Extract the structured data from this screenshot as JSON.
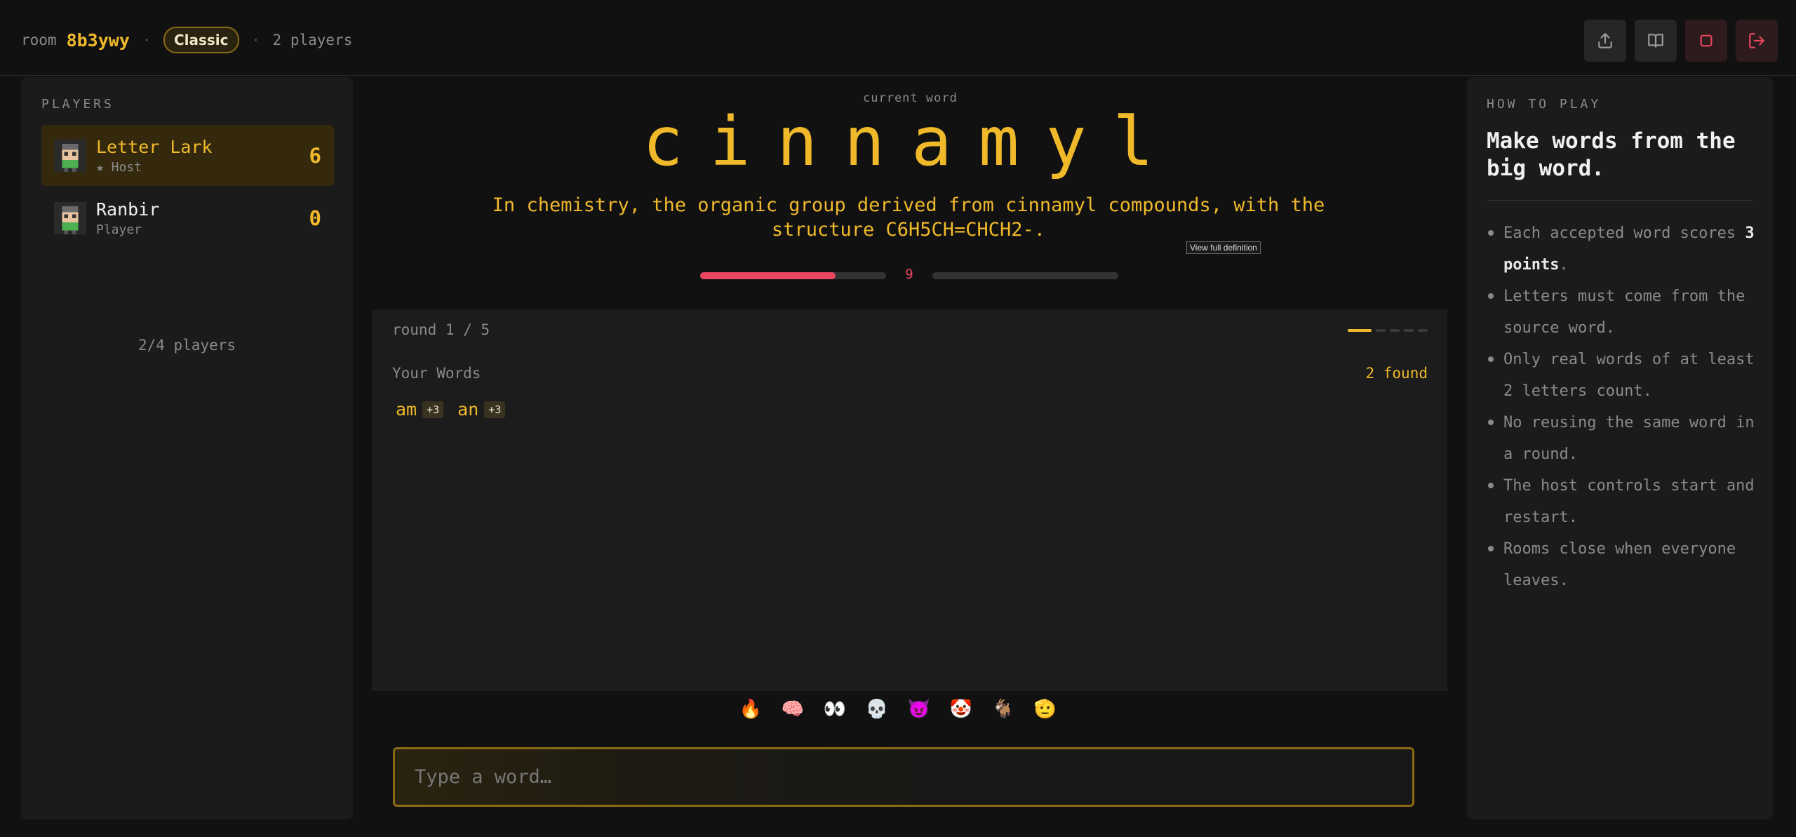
{
  "header": {
    "room_label": "room",
    "room_code": "8b3ywy",
    "separator": "·",
    "mode": "Classic",
    "player_count": "2 players",
    "buttons": [
      "share-icon",
      "book-icon",
      "stop-icon",
      "exit-icon"
    ]
  },
  "players_panel": {
    "title": "PLAYERS",
    "players": [
      {
        "name": "Letter Lark",
        "role": "★ Host",
        "score": "6",
        "is_me": true
      },
      {
        "name": "Ranbir",
        "role": "Player",
        "score": "0",
        "is_me": false
      }
    ],
    "capacity": "2/4 players"
  },
  "game": {
    "current_label": "current word",
    "word": "cinnamyl",
    "definition": "In chemistry, the organic group derived from cinnamyl compounds, with the structure C6H5CH=CHCH2-.",
    "view_definition": "View full definition",
    "timer": "9",
    "timer_fraction": 0.73,
    "round_label": "round 1 / 5",
    "round_current": 1,
    "round_total": 5,
    "your_words_title": "Your Words",
    "found_count": "2 found",
    "found_words": [
      {
        "word": "am",
        "points": "+3"
      },
      {
        "word": "an",
        "points": "+3"
      }
    ],
    "reactions": [
      "🔥",
      "🧠",
      "👀",
      "💀",
      "😈",
      "🤡",
      "🐐",
      "🫡"
    ],
    "input_placeholder": "Type a word…"
  },
  "how_to_play": {
    "title": "HOW TO PLAY",
    "headline": "Make words from the big word.",
    "rule_1_pre": "Each accepted word scores ",
    "rule_1_bold": "3 points",
    "rule_1_post": ".",
    "rules": [
      "Letters must come from the source word.",
      "Only real words of at least 2 letters count.",
      "No reusing the same word in a round.",
      "The host controls start and restart.",
      "Rooms close when everyone leaves."
    ]
  },
  "colors": {
    "accent": "#f0b92a",
    "danger": "#e8475f",
    "background": "#111111",
    "panel": "#1b1b1b"
  }
}
